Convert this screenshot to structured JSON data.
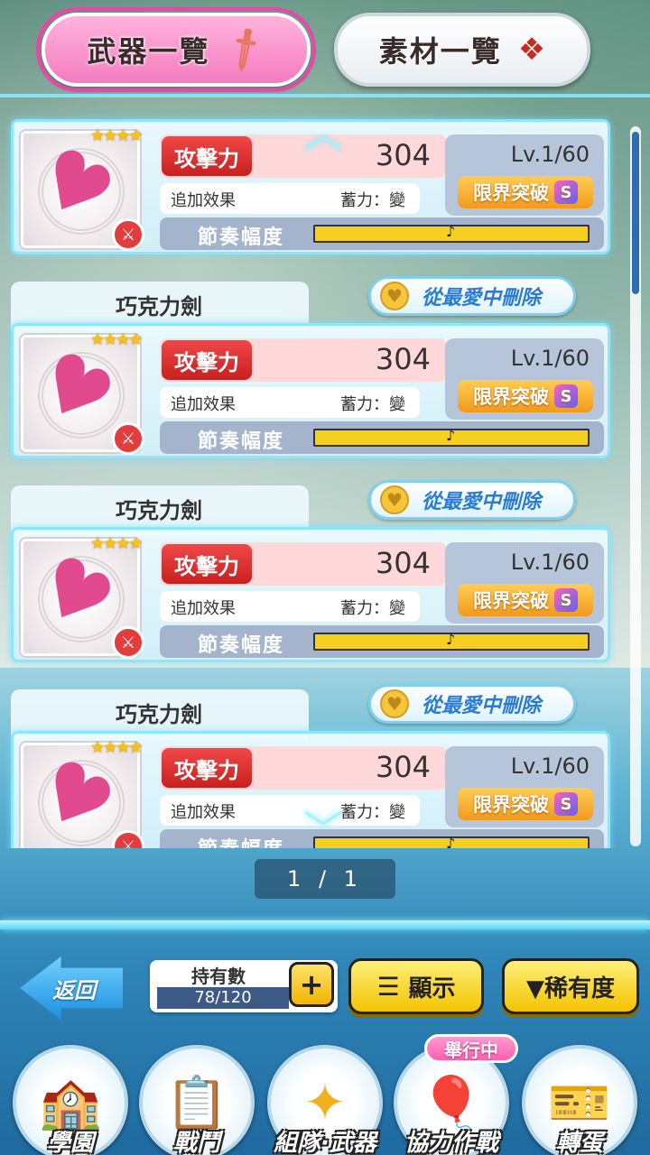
{
  "tabs": {
    "weapons": "武器一覽",
    "materials": "素材一覽"
  },
  "weapon_list": [
    {
      "name": "",
      "stars": "★★★★",
      "atk_label": "攻擊力",
      "atk": "304",
      "effect_label": "追加效果",
      "effect_value": "蓄力：變",
      "level": "Lv.1/60",
      "limit_break": "限界突破",
      "rank": "S",
      "rhythm_label": "節奏幅度"
    },
    {
      "name": "巧克力劍",
      "fav_button": "從最愛中刪除",
      "stars": "★★★★",
      "atk_label": "攻擊力",
      "atk": "304",
      "effect_label": "追加效果",
      "effect_value": "蓄力：變",
      "level": "Lv.1/60",
      "limit_break": "限界突破",
      "rank": "S",
      "rhythm_label": "節奏幅度"
    },
    {
      "name": "巧克力劍",
      "fav_button": "從最愛中刪除",
      "stars": "★★★★",
      "atk_label": "攻擊力",
      "atk": "304",
      "effect_label": "追加效果",
      "effect_value": "蓄力：變",
      "level": "Lv.1/60",
      "limit_break": "限界突破",
      "rank": "S",
      "rhythm_label": "節奏幅度"
    },
    {
      "name": "巧克力劍",
      "fav_button": "從最愛中刪除",
      "stars": "★★★★",
      "atk_label": "攻擊力",
      "atk": "304",
      "effect_label": "追加效果",
      "effect_value": "蓄力：變",
      "level": "Lv.1/60",
      "limit_break": "限界突破",
      "rank": "S",
      "rhythm_label": "節奏幅度"
    }
  ],
  "pager": "1 / 1",
  "controls": {
    "back": "返回",
    "owned_label": "持有數",
    "owned_value": "78/120",
    "plus": "+",
    "display": "顯示",
    "rarity": "▼稀有度"
  },
  "nav": {
    "academy": "學園",
    "battle": "戰鬥",
    "team_weapon": "組隊·武器",
    "coop": "協力作戰",
    "gacha": "轉蛋",
    "event_badge": "舉行中"
  },
  "colors": {
    "accent_pink": "#f47cc0",
    "attack_red": "#d42a2a",
    "button_yellow": "#f3c400",
    "link_blue": "#2a7bd6"
  },
  "icons": {
    "weapons_tab": "sword-icon",
    "materials_tab": "treasure-chest-icon",
    "favorite": "heart-lock-icon",
    "weapon_type": "sword-type-icon",
    "rhythm": "music-note-icon"
  }
}
